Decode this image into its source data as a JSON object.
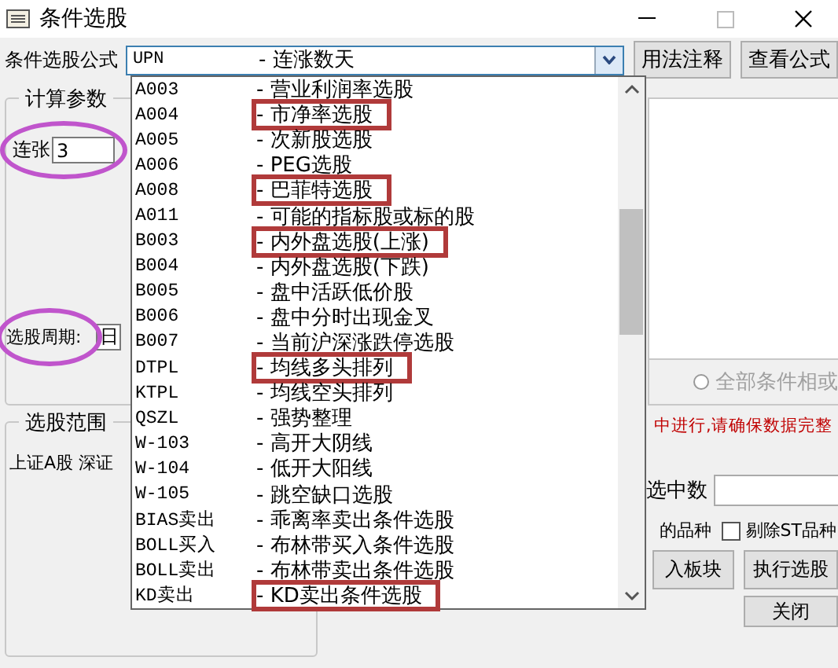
{
  "window": {
    "title": "条件选股"
  },
  "formula": {
    "label": "条件选股公式",
    "code": "UPN",
    "name": "- 连涨数天",
    "expanded": true
  },
  "buttons_top": [
    "用法注释",
    "查看公式"
  ],
  "params": {
    "title": "计算参数",
    "field_label": "连张",
    "field_value": "3",
    "field_circled": true,
    "period_label": "选股周期:",
    "period_value": "日",
    "period_circled": true
  },
  "formula_list": [
    {
      "code": "A003",
      "name": "- 营业利润率选股",
      "highlighted": false
    },
    {
      "code": "A004",
      "name": "- 市净率选股",
      "highlighted": true
    },
    {
      "code": "A005",
      "name": "- 次新股选股",
      "highlighted": false
    },
    {
      "code": "A006",
      "name": "- PEG选股",
      "highlighted": false
    },
    {
      "code": "A008",
      "name": "- 巴菲特选股",
      "highlighted": true
    },
    {
      "code": "A011",
      "name": "- 可能的指标股或标的股",
      "highlighted": false
    },
    {
      "code": "B003",
      "name": "- 内外盘选股(上涨)",
      "highlighted": true
    },
    {
      "code": "B004",
      "name": "- 内外盘选股(下跌)",
      "highlighted": false
    },
    {
      "code": "B005",
      "name": "- 盘中活跃低价股",
      "highlighted": false
    },
    {
      "code": "B006",
      "name": "- 盘中分时出现金叉",
      "highlighted": false
    },
    {
      "code": "B007",
      "name": "- 当前沪深涨跌停选股",
      "highlighted": false
    },
    {
      "code": "DTPL",
      "name": "- 均线多头排列",
      "highlighted": true
    },
    {
      "code": "KTPL",
      "name": "- 均线空头排列",
      "highlighted": false
    },
    {
      "code": "QSZL",
      "name": "- 强势整理",
      "highlighted": false
    },
    {
      "code": "W-103",
      "name": "- 高开大阴线",
      "highlighted": false
    },
    {
      "code": "W-104",
      "name": "- 低开大阳线",
      "highlighted": false
    },
    {
      "code": "W-105",
      "name": "- 跳空缺口选股",
      "highlighted": false
    },
    {
      "code": "BIAS卖出",
      "name": "- 乖离率卖出条件选股",
      "highlighted": false
    },
    {
      "code": "BOLL买入",
      "name": "- 布林带买入条件选股",
      "highlighted": false
    },
    {
      "code": "BOLL卖出",
      "name": "- 布林带卖出条件选股",
      "highlighted": false
    },
    {
      "code": "KD卖出",
      "name": "- KD卖出条件选股",
      "highlighted": true
    }
  ],
  "logic": {
    "label": "全部条件相或",
    "selected": false,
    "disabled": true
  },
  "range": {
    "title": "选股范围",
    "text": "上证A股 深证"
  },
  "warning": "中进行,请确保数据完整",
  "selected_count": {
    "label": "选中数"
  },
  "varieties_label": "的品种",
  "exclude_st": {
    "label": "剔除ST品种",
    "checked": false
  },
  "buttons_bottom": [
    "入板块",
    "执行选股",
    "关闭"
  ]
}
